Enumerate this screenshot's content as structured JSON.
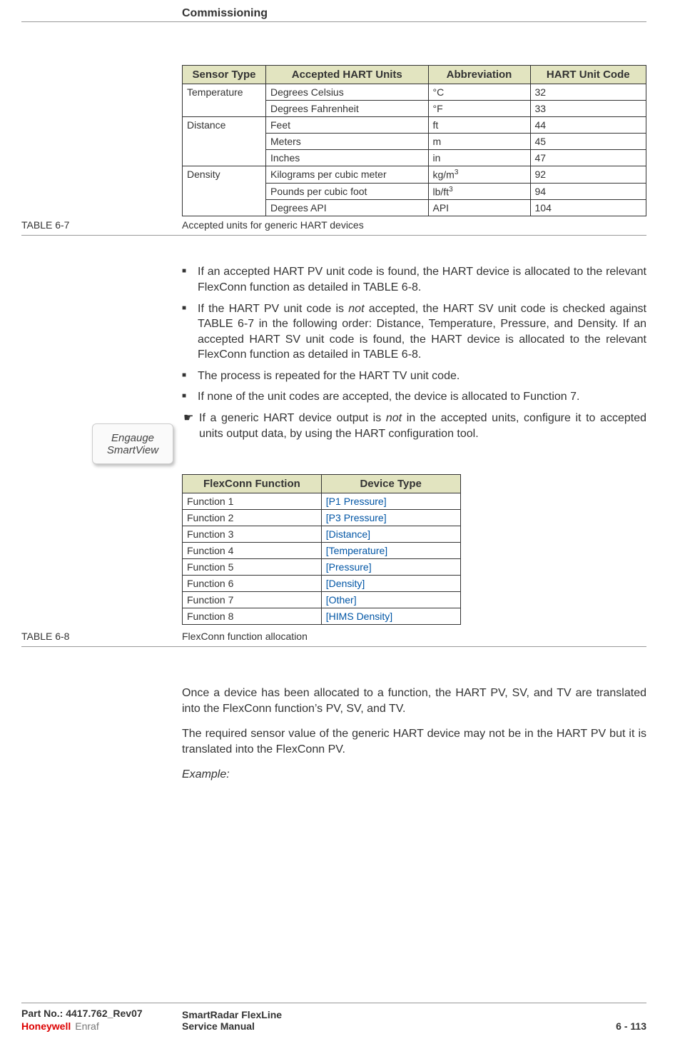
{
  "header": {
    "title": "Commissioning"
  },
  "table67": {
    "headers": [
      "Sensor Type",
      "Accepted HART Units",
      "Abbreviation",
      "HART Unit Code"
    ],
    "rows": [
      {
        "sensor": "Temperature",
        "unit": "Degrees Celsius",
        "abbr": "°C",
        "code": "32"
      },
      {
        "sensor": "",
        "unit": "Degrees Fahrenheit",
        "abbr": "°F",
        "code": "33"
      },
      {
        "sensor": "Distance",
        "unit": "Feet",
        "abbr": "ft",
        "code": "44"
      },
      {
        "sensor": "",
        "unit": "Meters",
        "abbr": "m",
        "code": "45"
      },
      {
        "sensor": "",
        "unit": "Inches",
        "abbr": "in",
        "code": "47"
      },
      {
        "sensor": "Density",
        "unit": "Kilograms per cubic meter",
        "abbr_html": "kg/m<sup>3</sup>",
        "code": "92"
      },
      {
        "sensor": "",
        "unit": "Pounds per cubic foot",
        "abbr_html": "lb/ft<sup>3</sup>",
        "code": "94"
      },
      {
        "sensor": "",
        "unit": "Degrees API",
        "abbr": "API",
        "code": "104"
      }
    ],
    "caption_left": "TABLE  6-7",
    "caption_right": "Accepted units for generic HART devices"
  },
  "bullets": [
    "If an accepted HART PV unit code is found, the HART device is allocated to the relevant FlexConn function as detailed in TABLE 6-8.",
    "If the HART PV unit code is <i>not</i> accepted, the HART SV unit code is checked against TABLE 6-7 in the following order: Distance, Temperature, Pressure, and Density. If an accepted HART SV unit code is found, the HART device is allocated to the relevant FlexConn function as detailed in TABLE 6-8.",
    "The process is repeated for the HART TV unit code.",
    "If none of the unit codes are accepted, the device is allocated to Function 7."
  ],
  "pointer": {
    "img_line1": "Engauge",
    "img_line2": "SmartView",
    "text": "If a generic HART device output is <i>not</i> in the accepted units, configure it to accepted units output data, by using the HART config­uration tool."
  },
  "table68": {
    "headers": [
      "FlexConn Function",
      "Device Type"
    ],
    "rows": [
      {
        "fn": "Function 1",
        "dt": "[P1 Pressure]"
      },
      {
        "fn": "Function 2",
        "dt": "[P3 Pressure]"
      },
      {
        "fn": "Function 3",
        "dt": "[Distance]"
      },
      {
        "fn": "Function 4",
        "dt": "[Temperature]"
      },
      {
        "fn": "Function 5",
        "dt": "[Pressure]"
      },
      {
        "fn": "Function 6",
        "dt": "[Density]"
      },
      {
        "fn": "Function 7",
        "dt": "[Other]"
      },
      {
        "fn": "Function 8",
        "dt": "[HIMS Density]"
      }
    ],
    "caption_left": "TABLE  6-8",
    "caption_right": "FlexConn function allocation"
  },
  "paras": [
    "Once a device has been allocated to a function, the HART PV, SV, and TV are translated into the FlexConn function’s PV, SV, and TV.",
    "The required sensor value of the generic HART device may not be in the HART PV but it is translated into the FlexConn PV."
  ],
  "example_label": "Example:",
  "footer": {
    "part": "Part No.: 4417.762_Rev07",
    "logo1": "Honeywell",
    "logo2": "Enraf",
    "title": "SmartRadar FlexLine",
    "subtitle": "Service Manual",
    "page": "6 - 113"
  }
}
